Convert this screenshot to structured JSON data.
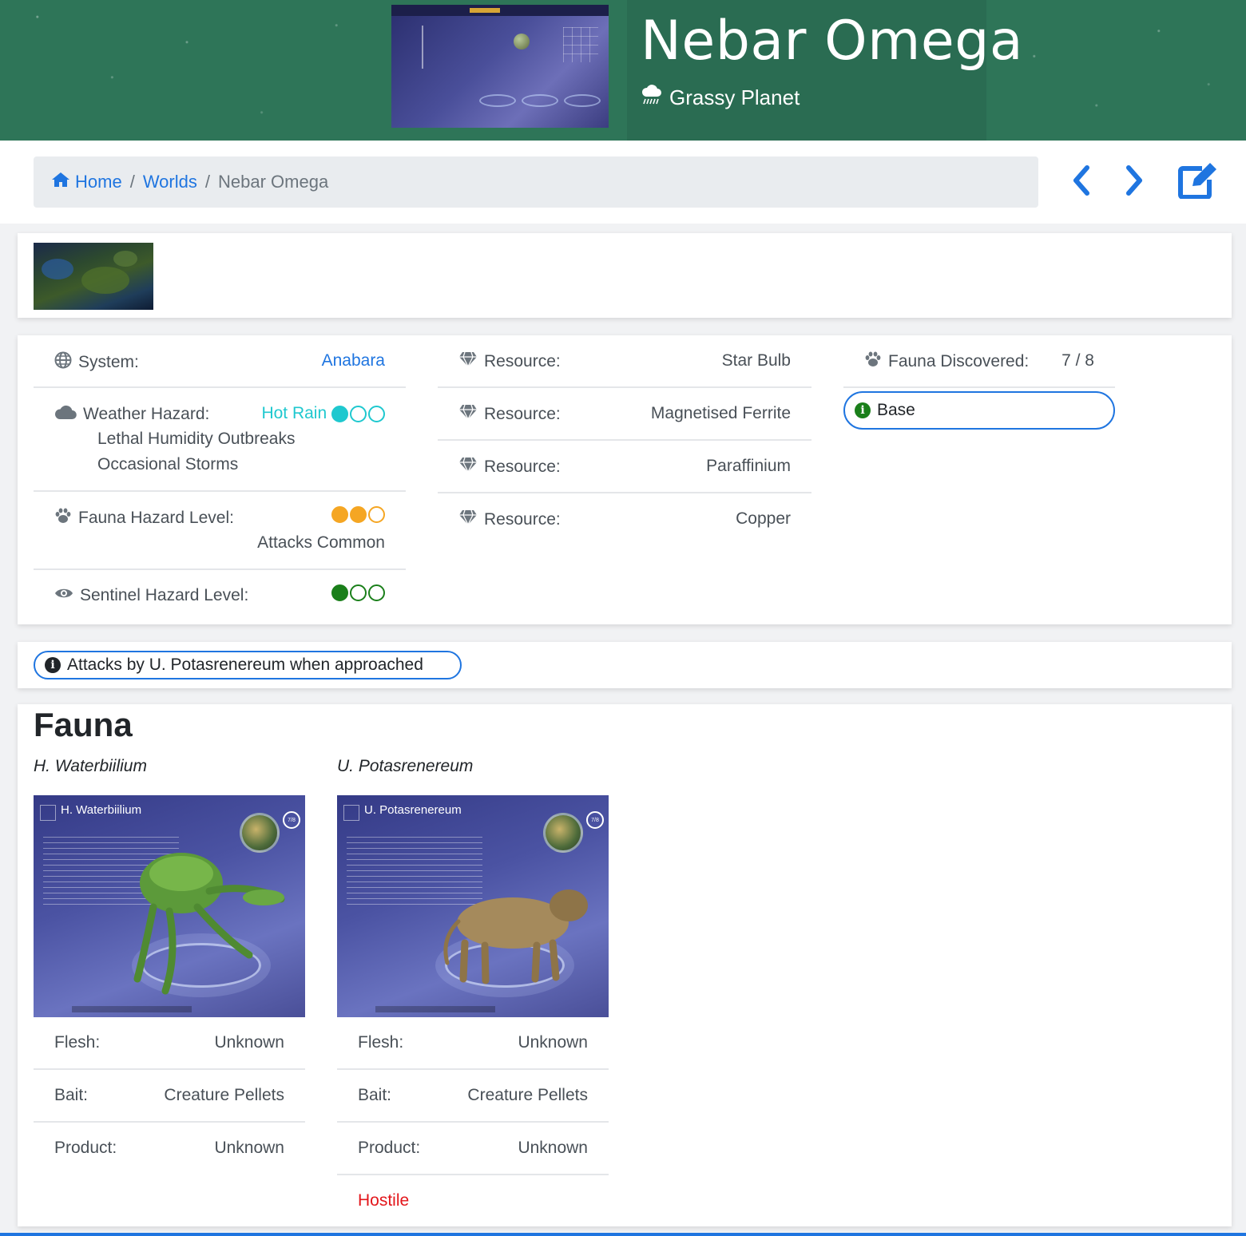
{
  "header": {
    "title": "Nebar Omega",
    "subtitle": "Grassy Planet",
    "weather_icon": "rain-cloud-icon"
  },
  "breadcrumb": {
    "home": "Home",
    "worlds": "Worlds",
    "current": "Nebar Omega"
  },
  "actions": {
    "prev_icon": "chevron-left-icon",
    "next_icon": "chevron-right-icon",
    "edit_icon": "edit-icon"
  },
  "info": {
    "system_label": "System:",
    "system_value": "Anabara",
    "weather_label": "Weather Hazard:",
    "weather_value": "Hot Rain",
    "weather_level": 1,
    "weather_notes": [
      "Lethal Humidity Outbreaks",
      "Occasional Storms"
    ],
    "fauna_hazard_label": "Fauna Hazard Level:",
    "fauna_hazard_level": 2,
    "fauna_hazard_note": "Attacks Common",
    "sentinel_label": "Sentinel Hazard Level:",
    "sentinel_level": 1,
    "resource_label": "Resource:",
    "resources": [
      "Star Bulb",
      "Magnetised Ferrite",
      "Paraffinium",
      "Copper"
    ],
    "fauna_discovered_label": "Fauna Discovered:",
    "fauna_discovered_value": "7 / 8",
    "base_label": "Base",
    "colors": {
      "link": "#1f75e0",
      "teal": "#1fc8cf",
      "orange": "#f5a623",
      "green": "#1a7f1a",
      "hostile": "#e3161b"
    }
  },
  "note": "Attacks by U. Potasrenereum when approached",
  "fauna": {
    "heading": "Fauna",
    "creatures": [
      {
        "name": "H. Waterbiilium",
        "image_title": "H. Waterbiilium",
        "counter": "7/8",
        "flesh_label": "Flesh:",
        "flesh": "Unknown",
        "bait_label": "Bait:",
        "bait": "Creature Pellets",
        "product_label": "Product:",
        "product": "Unknown"
      },
      {
        "name": "U. Potasrenereum",
        "image_title": "U. Potasrenereum",
        "counter": "7/8",
        "flesh_label": "Flesh:",
        "flesh": "Unknown",
        "bait_label": "Bait:",
        "bait": "Creature Pellets",
        "product_label": "Product:",
        "product": "Unknown",
        "tag": "Hostile"
      }
    ]
  }
}
